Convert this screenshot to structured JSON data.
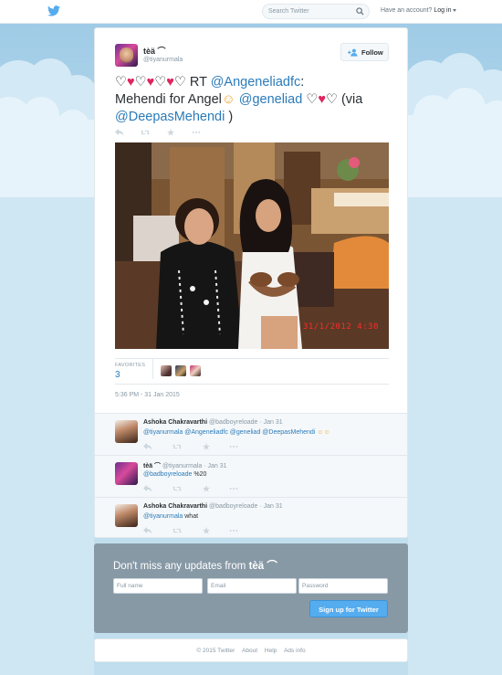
{
  "topbar": {
    "search_placeholder": "Search Twitter",
    "login_prompt": "Have an account?",
    "login_link": "Log in"
  },
  "tweet": {
    "author_name": "tèä ⌒",
    "author_handle": "@tiyanurmala",
    "follow_label": "Follow",
    "text_parts": {
      "hearts1_a": "♡",
      "hearts1_b": "♥",
      "hearts1_c": "♡",
      "hearts1_d": "♥",
      "hearts1_e": "♡",
      "hearts1_f": "♥",
      "hearts1_g": "♡",
      "rt": " RT ",
      "mention1": "@Angeneliadfc",
      "colon": ":",
      "line2_text": "Mehendi for Angel",
      "emoji_blush": "☺",
      "mention2": "@geneliad",
      "hearts2_a": " ♡",
      "hearts2_b": "♥",
      "hearts2_c": "♡",
      "via": " (via",
      "mention3": "@DeepasMehendi",
      "close_paren": " )"
    },
    "photo_stamp": "31/1/2012   4:30",
    "favorites_label": "FAVORITES",
    "favorites_count": "3",
    "timestamp": "5:36 PM - 31 Jan 2015"
  },
  "replies": [
    {
      "name": "Ashoka Chakravarthi",
      "handle": "@badboyreloade",
      "date": "· Jan 31",
      "mentions": "@tiyanurmala @Angeneliadfc @geneliad @DeepasMehendi",
      "text": " ☺☺"
    },
    {
      "name": "tèä ⌒",
      "handle": "@tiyanurmala",
      "date": "· Jan 31",
      "mentions": "@badboyreloade",
      "text": " %20"
    },
    {
      "name": "Ashoka Chakravarthi",
      "handle": "@badboyreloade",
      "date": "· Jan 31",
      "mentions": "@tiyanurmala",
      "text": " what"
    }
  ],
  "signup": {
    "title_prefix": "Don't miss any updates from ",
    "title_name": "tèä ⌒",
    "fullname_placeholder": "Full name",
    "email_placeholder": "Email",
    "password_placeholder": "Password",
    "button_label": "Sign up for Twitter"
  },
  "footer": {
    "copyright": "© 2015 Twitter",
    "about": "About",
    "help": "Help",
    "ads_info": "Ads info"
  },
  "colors": {
    "brand": "#55acee",
    "link": "#2b7bb9",
    "heart": "#e0245e",
    "background": "#c0deed"
  }
}
